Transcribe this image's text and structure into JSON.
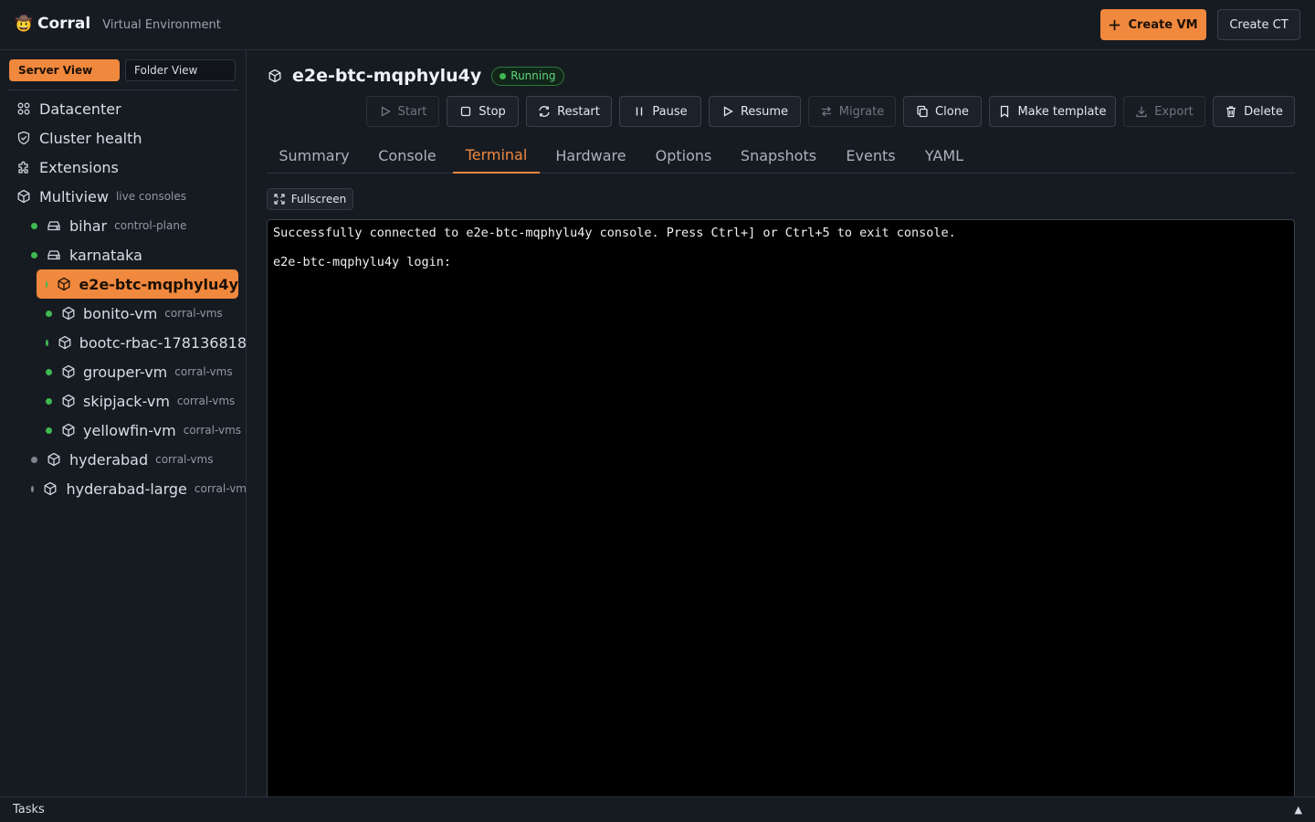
{
  "app": {
    "logo_icon": "cowboy-face-icon",
    "logo_glyph": "🤠",
    "name": "Corral",
    "subtitle": "Virtual Environment"
  },
  "header_actions": {
    "create_vm": "Create VM",
    "create_ct": "Create CT"
  },
  "sidebar": {
    "view_toggle": {
      "server_view": "Server View",
      "folder_view": "Folder View",
      "active": "Server View"
    },
    "nav": [
      {
        "label": "Datacenter",
        "icon": "grid-icon"
      },
      {
        "label": "Cluster health",
        "icon": "shield-check-icon"
      },
      {
        "label": "Extensions",
        "icon": "puzzle-icon"
      },
      {
        "label": "Multiview",
        "sub": "live consoles",
        "icon": "cube-icon"
      }
    ],
    "nodes": [
      {
        "label": "bihar",
        "sub": "control-plane",
        "status": "online",
        "icon": "server-icon"
      },
      {
        "label": "karnataka",
        "sub": "",
        "status": "online",
        "icon": "server-icon"
      }
    ],
    "vms": [
      {
        "label": "e2e-btc-mqphylu4y",
        "sub": "",
        "status": "running",
        "selected": true
      },
      {
        "label": "bonito-vm",
        "sub": "corral-vms",
        "status": "running"
      },
      {
        "label": "bootc-rbac-178136818",
        "sub": "",
        "status": "running"
      },
      {
        "label": "grouper-vm",
        "sub": "corral-vms",
        "status": "running"
      },
      {
        "label": "skipjack-vm",
        "sub": "corral-vms",
        "status": "running"
      },
      {
        "label": "yellowfin-vm",
        "sub": "corral-vms",
        "status": "running"
      }
    ],
    "other": [
      {
        "label": "hyderabad",
        "sub": "corral-vms",
        "status": "stopped"
      },
      {
        "label": "hyderabad-large",
        "sub": "corral-vm",
        "status": "stopped"
      }
    ]
  },
  "vm": {
    "name": "e2e-btc-mqphylu4y",
    "status": "Running",
    "status_color": "#3fb950"
  },
  "actions": {
    "start": "Start",
    "stop": "Stop",
    "restart": "Restart",
    "pause": "Pause",
    "resume": "Resume",
    "migrate": "Migrate",
    "clone": "Clone",
    "make_template": "Make template",
    "export": "Export",
    "delete": "Delete"
  },
  "tabs": [
    "Summary",
    "Console",
    "Terminal",
    "Hardware",
    "Options",
    "Snapshots",
    "Events",
    "YAML"
  ],
  "active_tab": "Terminal",
  "terminal": {
    "fullscreen_label": "Fullscreen",
    "lines": [
      "Successfully connected to e2e-btc-mqphylu4y console. Press Ctrl+] or Ctrl+5 to exit console.",
      "e2e-btc-mqphylu4y login:"
    ]
  },
  "tasks": {
    "label": "Tasks",
    "toggle": "▲"
  },
  "colors": {
    "accent": "#f0883e",
    "background": "#161b22",
    "running": "#3fb950",
    "stopped": "#7d8590"
  }
}
